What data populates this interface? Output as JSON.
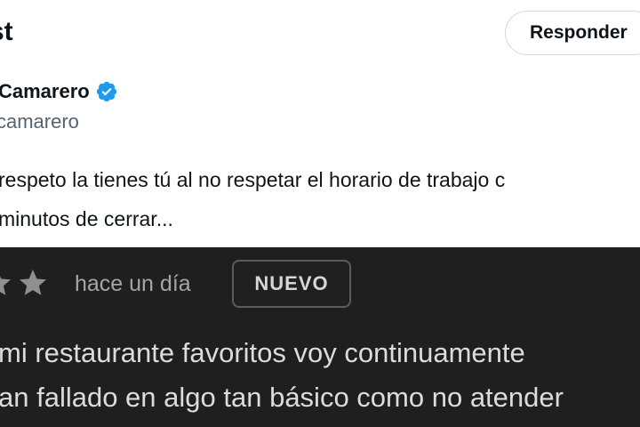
{
  "header": {
    "title": "st"
  },
  "toolbar": {
    "reply_label": "Responder"
  },
  "tweet": {
    "author_name": "Camarero",
    "handle": "camarero",
    "text_lines": [
      "respeto la tienes tú al no respetar el horario de trabajo c",
      "minutos de cerrar..."
    ]
  },
  "review_image": {
    "stars_visible": 2,
    "time_ago": "hace un día",
    "badge": "NUEVO",
    "text_lines": [
      "mi restaurante favoritos voy continuamente",
      "an fallado en algo tan básico como no atender"
    ]
  },
  "colors": {
    "verified_badge": "#1d9bf0",
    "review_background": "#1f1f1f",
    "star_color": "#8f8f8f"
  }
}
